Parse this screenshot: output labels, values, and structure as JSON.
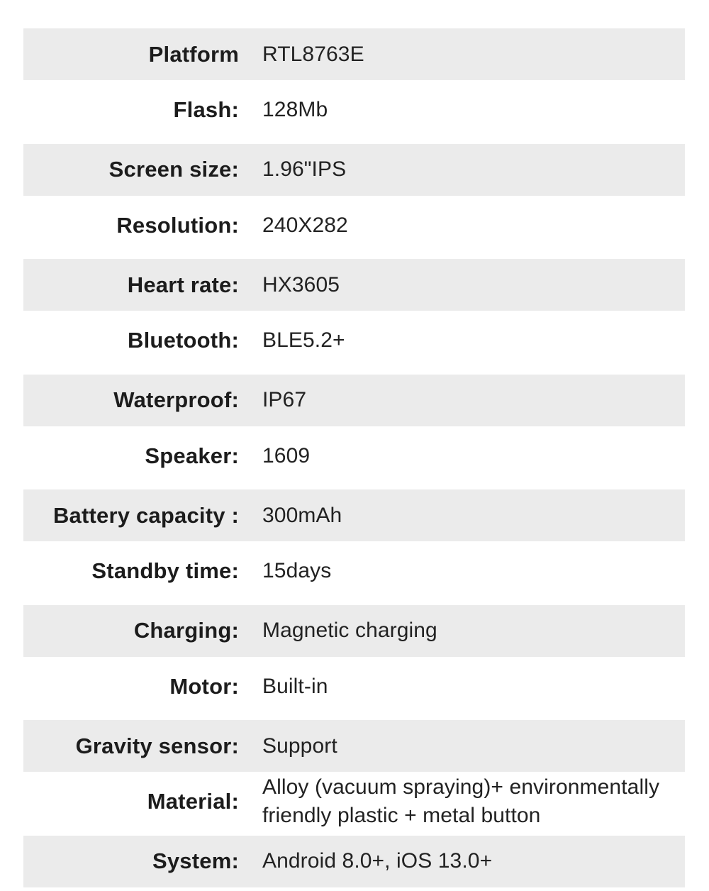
{
  "specs": [
    {
      "label": "Platform",
      "value": "RTL8763E"
    },
    {
      "label": "Flash:",
      "value": "128Mb"
    },
    {
      "label": "Screen size:",
      "value": "1.96\"IPS"
    },
    {
      "label": "Resolution:",
      "value": "240X282"
    },
    {
      "label": "Heart rate:",
      "value": "HX3605"
    },
    {
      "label": "Bluetooth:",
      "value": "BLE5.2+"
    },
    {
      "label": "Waterproof:",
      "value": "IP67"
    },
    {
      "label": "Speaker:",
      "value": "1609"
    },
    {
      "label": "Battery capacity :",
      "value": "300mAh"
    },
    {
      "label": "Standby time:",
      "value": "15days"
    },
    {
      "label": "Charging:",
      "value": "Magnetic charging"
    },
    {
      "label": "Motor:",
      "value": "Built-in"
    },
    {
      "label": "Gravity sensor:",
      "value": "Support"
    },
    {
      "label": "Material:",
      "value": "Alloy (vacuum spraying)+ environmentally friendly plastic + metal button"
    },
    {
      "label": "System:",
      "value": "Android 8.0+, iOS 13.0+"
    }
  ],
  "colors": {
    "shaded_row": "#ebebeb",
    "background": "#ffffff",
    "text": "#1c1c1c"
  }
}
